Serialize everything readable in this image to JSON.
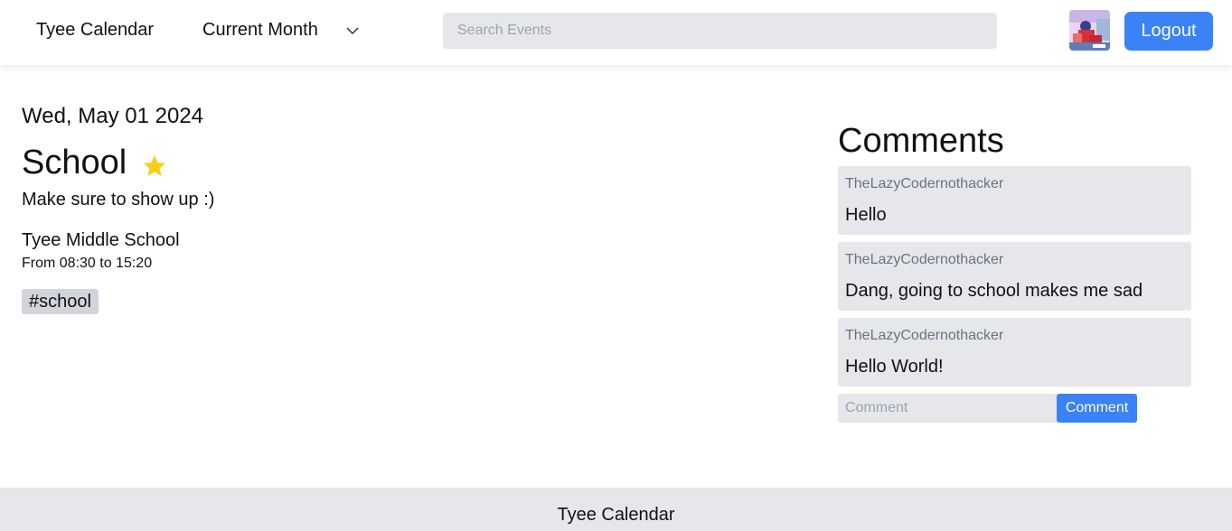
{
  "navbar": {
    "brand": "Tyee Calendar",
    "month_select": {
      "selected": "Current Month",
      "icon": "chevron-down-icon"
    },
    "search": {
      "placeholder": "Search Events",
      "value": ""
    },
    "avatar": {
      "icon": "user-avatar"
    },
    "logout_label": "Logout",
    "accent": "#3b82f6"
  },
  "event": {
    "date": "Wed, May 01 2024",
    "title": "School",
    "starred": true,
    "star_color": "#facc15",
    "description": "Make sure to show up :)",
    "location": "Tyee Middle School",
    "time": "From 08:30 to 15:20",
    "tags": [
      "#school"
    ]
  },
  "comments": {
    "title": "Comments",
    "items": [
      {
        "author": "TheLazyCodernothacker",
        "text": "Hello"
      },
      {
        "author": "TheLazyCodernothacker",
        "text": "Dang, going to school makes me sad"
      },
      {
        "author": "TheLazyCodernothacker",
        "text": "Hello World!"
      }
    ],
    "input": {
      "placeholder": "Comment",
      "value": ""
    },
    "submit_label": "Comment"
  },
  "footer": {
    "text": "Tyee Calendar"
  }
}
